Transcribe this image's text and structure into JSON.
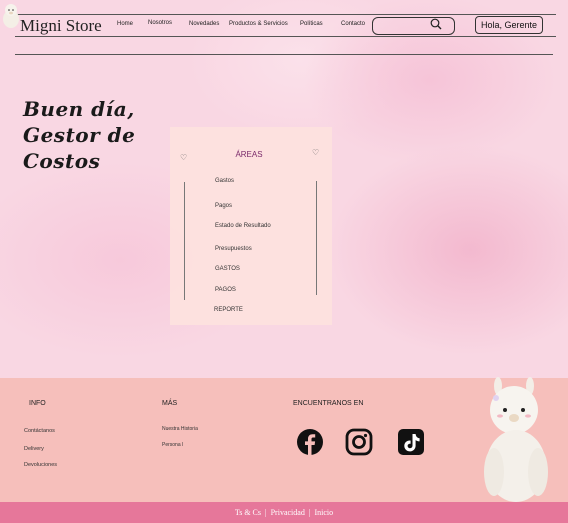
{
  "header": {
    "brand": "Migni Store",
    "nav": [
      "Home",
      "Nosotros",
      "Novedades",
      "Productos & Servicios",
      "Políticas",
      "Contacto"
    ],
    "search_placeholder": "",
    "greeting_button": "Hola, Gerente"
  },
  "hero": {
    "greeting_lines": [
      "Buen día,",
      "Gestor de",
      "Costos"
    ]
  },
  "panel": {
    "title": "ÁREAS",
    "items": [
      "Gastos",
      "Pagos",
      "Estado de Resultado",
      "Presupuestos",
      "GASTOS",
      "PAGOS",
      "REPORTE"
    ]
  },
  "footer": {
    "info_title": "INFO",
    "info_links": [
      "Contáctanos",
      "Delivery",
      "Devoluciones"
    ],
    "more_title": "MÁS",
    "more_links": [
      "Nuestra Historia",
      "Persona l"
    ],
    "social_title": "ENCUENTRANOS EN",
    "social_icons": [
      "facebook-icon",
      "instagram-icon",
      "tiktok-icon"
    ]
  },
  "bottom_bar": {
    "links": [
      "Ts & Cs",
      "|",
      "Privacidad",
      "|",
      "Inicio"
    ]
  },
  "colors": {
    "footer_bg": "#f6bfbb",
    "bottom_bar": "#e6779a",
    "panel_bg": "#fde2de",
    "panel_title": "#7a2a6a"
  }
}
